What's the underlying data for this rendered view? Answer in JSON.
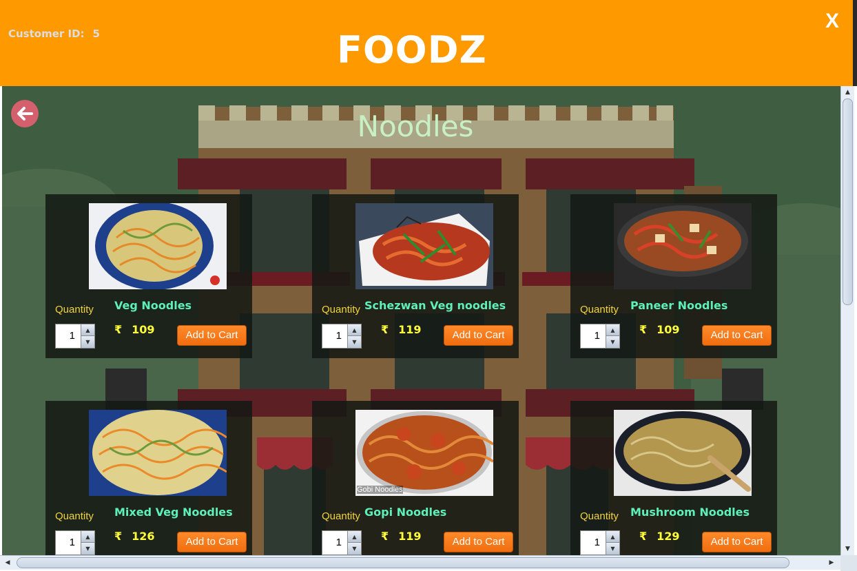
{
  "header": {
    "customer_label": "Customer ID:",
    "customer_id": "5",
    "brand": "FOODZ",
    "close_label": "X",
    "color": "#ff9900"
  },
  "page": {
    "title": "Noodles",
    "back_icon": "back-arrow-icon"
  },
  "common": {
    "quantity_label": "Quantity",
    "add_to_cart": "Add to Cart",
    "currency": "₹"
  },
  "items": [
    {
      "name": "Veg Noodles",
      "price": "109",
      "quantity": "1",
      "photo_caption": ""
    },
    {
      "name": "Schezwan Veg noodles",
      "price": "119",
      "quantity": "1",
      "photo_caption": ""
    },
    {
      "name": "Paneer Noodles",
      "price": "109",
      "quantity": "1",
      "photo_caption": ""
    },
    {
      "name": "Mixed Veg Noodles",
      "price": "126",
      "quantity": "1",
      "photo_caption": ""
    },
    {
      "name": "Gopi Noodles",
      "price": "119",
      "quantity": "1",
      "photo_caption": "Gobi Noodles"
    },
    {
      "name": "Mushroom Noodles",
      "price": "129",
      "quantity": "1",
      "photo_caption": ""
    }
  ]
}
